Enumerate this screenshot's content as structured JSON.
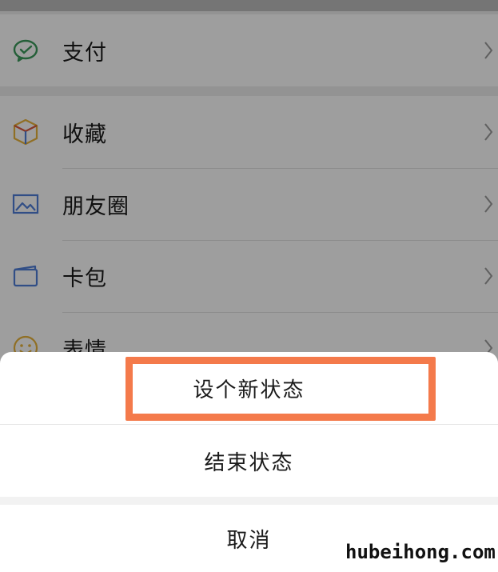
{
  "menu": {
    "pay": {
      "label": "支付",
      "icon": "wechat-pay-icon"
    },
    "items": [
      {
        "label": "收藏",
        "icon": "favorites-cube-icon"
      },
      {
        "label": "朋友圈",
        "icon": "moments-picture-icon"
      },
      {
        "label": "卡包",
        "icon": "card-wallet-icon"
      },
      {
        "label": "表情",
        "icon": "sticker-smiley-icon"
      }
    ]
  },
  "sheet": {
    "options": [
      {
        "label": "设个新状态"
      },
      {
        "label": "结束状态"
      }
    ],
    "cancel_label": "取消"
  },
  "highlight_color": "#f47a4b",
  "watermark": "hubeihong.com"
}
